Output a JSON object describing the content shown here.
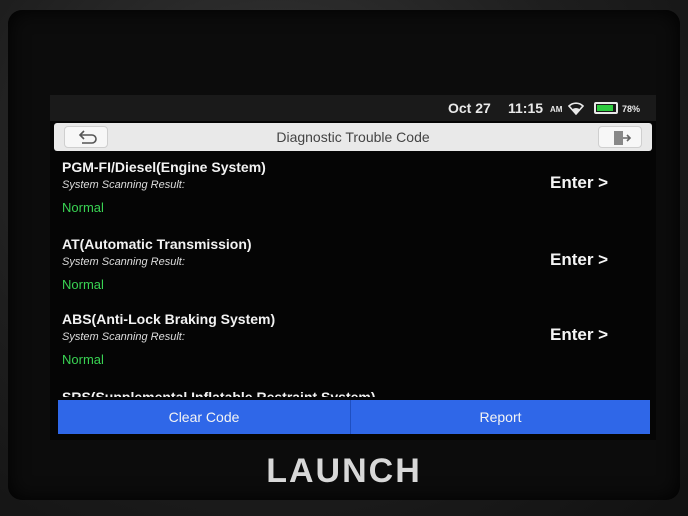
{
  "statusbar": {
    "date": "Oct 27",
    "time": "11:15",
    "ampm": "AM",
    "battery_pct": "78%",
    "battery_level": 0.78,
    "icons": [
      "wifi-icon",
      "battery-icon"
    ]
  },
  "header": {
    "title": "Diagnostic Trouble Code",
    "back_icon": "back-arrow-icon",
    "exit_icon": "exit-icon"
  },
  "systems": [
    {
      "name": "PGM-FI/Diesel(Engine System)",
      "subtitle": "System Scanning Result:",
      "status": "Normal",
      "action": "Enter >"
    },
    {
      "name": "AT(Automatic Transmission)",
      "subtitle": "System Scanning Result:",
      "status": "Normal",
      "action": "Enter >"
    },
    {
      "name": "ABS(Anti-Lock Braking System)",
      "subtitle": "System Scanning Result:",
      "status": "Normal",
      "action": "Enter >"
    },
    {
      "name": "SRS(Supplemental Inflatable Restraint System)"
    }
  ],
  "footer": {
    "clear_label": "Clear Code",
    "report_label": "Report"
  },
  "brand": "LAUNCH",
  "colors": {
    "accent": "#2f67e8",
    "normal": "#39d353"
  }
}
